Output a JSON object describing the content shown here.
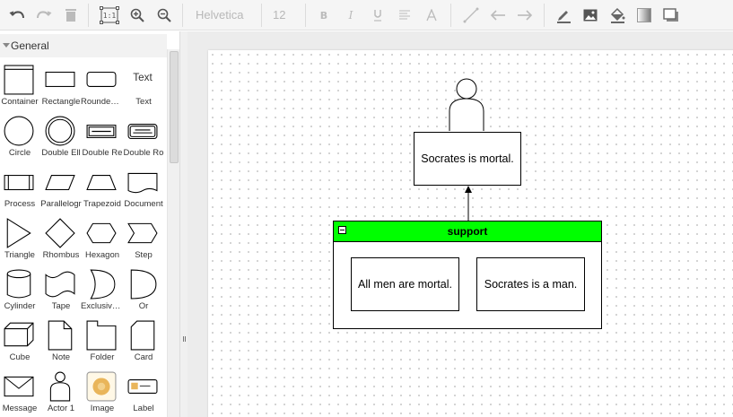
{
  "toolbar": {
    "font_family": "Helvetica",
    "font_size": "12"
  },
  "sidebar": {
    "section_title": "General",
    "shapes": [
      {
        "label": "Container",
        "icon": "container-shape-icon"
      },
      {
        "label": "Rectangle",
        "icon": "rectangle-shape-icon"
      },
      {
        "label": "Rounded R",
        "icon": "rounded-rectangle-shape-icon"
      },
      {
        "label": "Text",
        "icon": "text-shape-icon",
        "preview_text": "Text"
      },
      {
        "label": "Circle",
        "icon": "circle-shape-icon"
      },
      {
        "label": "Double Ell",
        "icon": "double-ellipse-shape-icon"
      },
      {
        "label": "Double Re",
        "icon": "double-rectangle-shape-icon"
      },
      {
        "label": "Double Ro",
        "icon": "double-rounded-rectangle-shape-icon"
      },
      {
        "label": "Process",
        "icon": "process-shape-icon"
      },
      {
        "label": "Parallelogr",
        "icon": "parallelogram-shape-icon"
      },
      {
        "label": "Trapezoid",
        "icon": "trapezoid-shape-icon"
      },
      {
        "label": "Document",
        "icon": "document-shape-icon"
      },
      {
        "label": "Triangle",
        "icon": "triangle-shape-icon"
      },
      {
        "label": "Rhombus",
        "icon": "rhombus-shape-icon"
      },
      {
        "label": "Hexagon",
        "icon": "hexagon-shape-icon"
      },
      {
        "label": "Step",
        "icon": "step-shape-icon"
      },
      {
        "label": "Cylinder",
        "icon": "cylinder-shape-icon"
      },
      {
        "label": "Tape",
        "icon": "tape-shape-icon"
      },
      {
        "label": "Exclusive O",
        "icon": "exclusive-or-shape-icon"
      },
      {
        "label": "Or",
        "icon": "or-shape-icon"
      },
      {
        "label": "Cube",
        "icon": "cube-shape-icon"
      },
      {
        "label": "Note",
        "icon": "note-shape-icon"
      },
      {
        "label": "Folder",
        "icon": "folder-shape-icon"
      },
      {
        "label": "Card",
        "icon": "card-shape-icon"
      },
      {
        "label": "Message",
        "icon": "message-shape-icon"
      },
      {
        "label": "Actor 1",
        "icon": "actor-shape-icon"
      },
      {
        "label": "Image",
        "icon": "image-shape-icon"
      },
      {
        "label": "Label",
        "icon": "label-shape-icon"
      }
    ]
  },
  "diagram": {
    "claim": "Socrates is mortal.",
    "container_title": "support",
    "premise_1": "All men are mortal.",
    "premise_2": "Socrates is a man.",
    "container_color": "#00ff00"
  }
}
